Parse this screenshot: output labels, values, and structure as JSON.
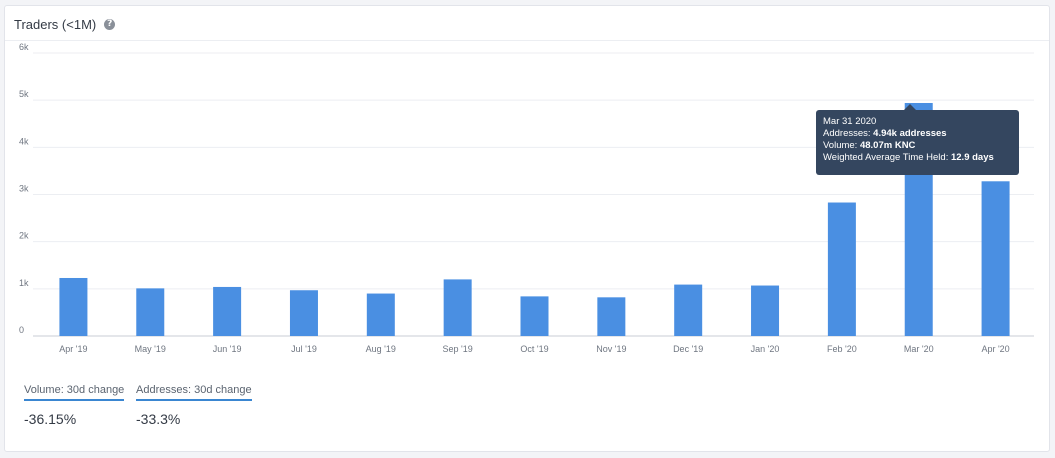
{
  "header": {
    "title": "Traders (<1M)",
    "help_icon": "question-circle-icon",
    "help_glyph": "?"
  },
  "tooltip": {
    "date": "Mar 31 2020",
    "addresses_label": "Addresses:",
    "addresses_value": "4.94k addresses",
    "volume_label": "Volume:",
    "volume_value": "48.07m KNC",
    "wath_label": "Weighted Average Time Held:",
    "wath_value": "12.9 days"
  },
  "stats": [
    {
      "label": "Volume: 30d change",
      "value": "-36.15%"
    },
    {
      "label": "Addresses: 30d change",
      "value": "-33.3%"
    }
  ],
  "colors": {
    "bar": "#4a8fe2",
    "accent": "#3a86d1",
    "tooltip_bg": "#34465f"
  },
  "chart_data": {
    "type": "bar",
    "title": "Traders (<1M)",
    "categories": [
      "Apr '19",
      "May '19",
      "Jun '19",
      "Jul '19",
      "Aug '19",
      "Sep '19",
      "Oct '19",
      "Nov '19",
      "Dec '19",
      "Jan '20",
      "Feb '20",
      "Mar '20",
      "Apr '20"
    ],
    "values": [
      1230,
      1010,
      1040,
      970,
      900,
      1200,
      840,
      820,
      1090,
      1070,
      2830,
      4940,
      3280
    ],
    "y_ticks": [
      "0",
      "1k",
      "2k",
      "3k",
      "4k",
      "5k",
      "6k"
    ],
    "ylim": [
      0,
      6000
    ],
    "grid": true,
    "xlabel": "",
    "ylabel": ""
  }
}
